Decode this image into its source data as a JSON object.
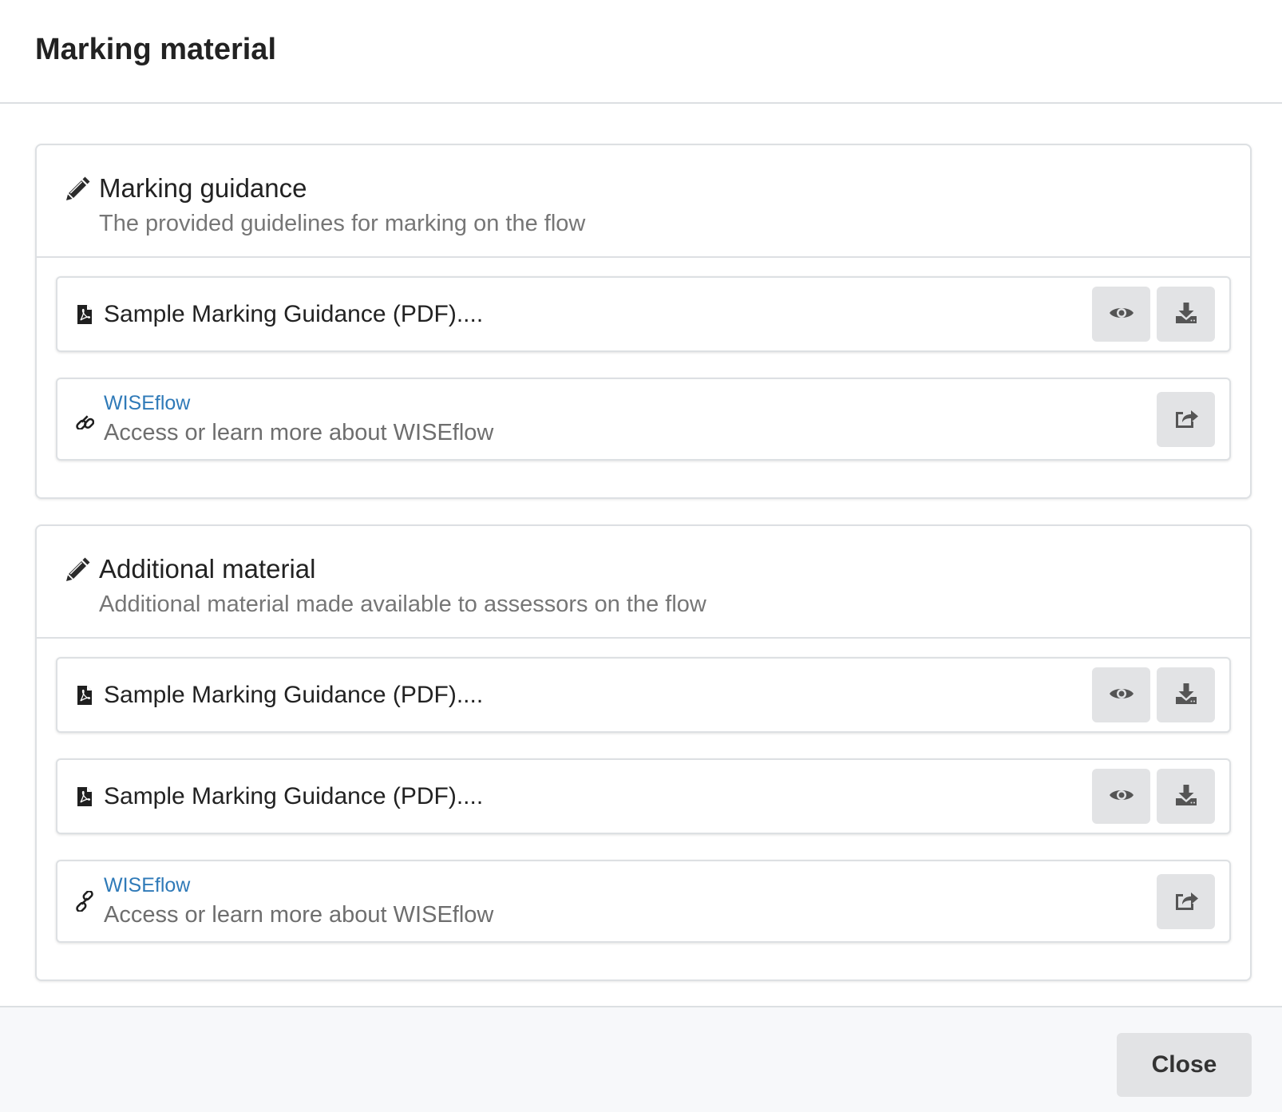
{
  "dialog": {
    "title": "Marking material",
    "close_label": "Close"
  },
  "sections": [
    {
      "icon": "pencil-icon",
      "title": "Marking guidance",
      "subtitle": "The provided guidelines for marking on the flow",
      "items": [
        {
          "type": "file",
          "icon": "pdf-file-icon",
          "name": "Sample Marking Guidance (PDF)...."
        },
        {
          "type": "link",
          "icon": "link-icon",
          "title": "WISEflow",
          "description": "Access or learn more about WISEflow"
        }
      ]
    },
    {
      "icon": "pencil-icon",
      "title": "Additional material",
      "subtitle": "Additional material made available to assessors on the flow",
      "items": [
        {
          "type": "file",
          "icon": "pdf-file-icon",
          "name": "Sample Marking Guidance (PDF)...."
        },
        {
          "type": "file",
          "icon": "pdf-file-icon",
          "name": "Sample Marking Guidance (PDF)...."
        },
        {
          "type": "link",
          "icon": "link-icon",
          "title": "WISEflow",
          "description": "Access or learn more about WISEflow"
        }
      ]
    }
  ],
  "colors": {
    "link": "#2f7ab8",
    "button_bg": "#e2e3e5",
    "muted_text": "#767676",
    "border": "#dde0e3",
    "footer_bg": "#f7f8fa"
  }
}
